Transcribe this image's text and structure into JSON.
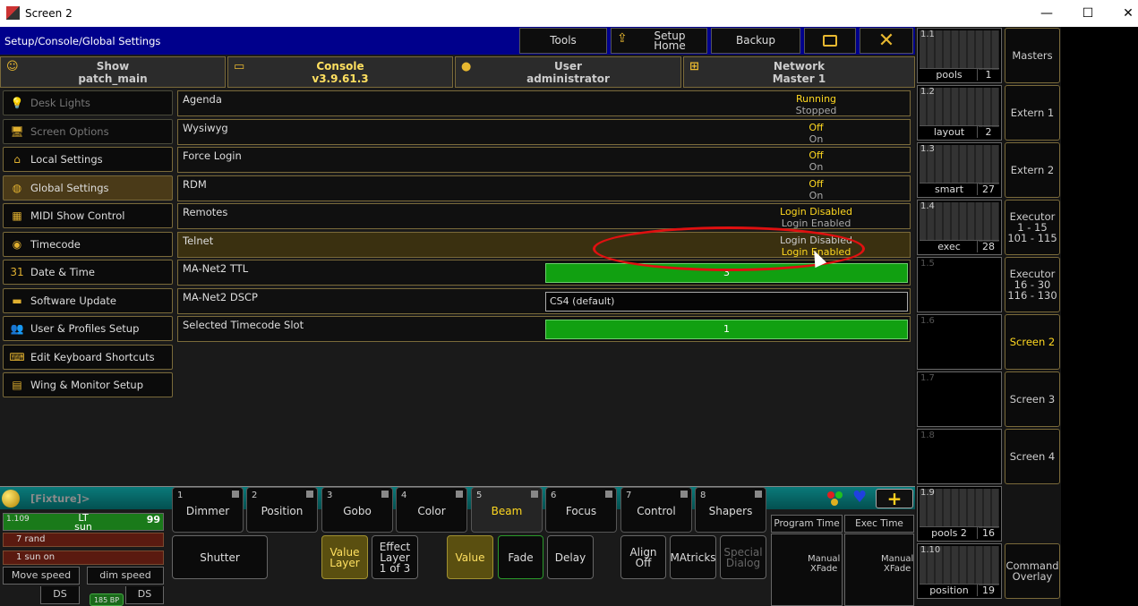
{
  "window": {
    "title": "Screen 2",
    "minimize": "—",
    "maximize": "☐",
    "close": "✕"
  },
  "pathbar": {
    "path": "Setup/Console/Global Settings",
    "tools": "Tools",
    "setup_home_1": "Setup",
    "setup_home_2": "Home",
    "backup": "Backup"
  },
  "tabs": [
    {
      "title": "Show",
      "sub": "patch_main"
    },
    {
      "title": "Console",
      "sub": "v3.9.61.3"
    },
    {
      "title": "User",
      "sub": "administrator"
    },
    {
      "title": "Network",
      "sub": "Master 1"
    }
  ],
  "sidebar": [
    {
      "label": "Desk Lights",
      "icon": "💡"
    },
    {
      "label": "Screen Options",
      "icon": "🖥"
    },
    {
      "label": "Local Settings",
      "icon": "⌂"
    },
    {
      "label": "Global Settings",
      "icon": "◍"
    },
    {
      "label": "MIDI Show Control",
      "icon": "▦"
    },
    {
      "label": "Timecode",
      "icon": "◉"
    },
    {
      "label": "Date & Time",
      "icon": "31"
    },
    {
      "label": "Software Update",
      "icon": "▬"
    },
    {
      "label": "User & Profiles Setup",
      "icon": "👥"
    },
    {
      "label": "Edit Keyboard Shortcuts",
      "icon": "⌨"
    },
    {
      "label": "Wing & Monitor Setup",
      "icon": "▤"
    }
  ],
  "settings": [
    {
      "label": "Agenda",
      "v1": "Running",
      "v2": "Stopped"
    },
    {
      "label": "Wysiwyg",
      "v1": "Off",
      "v2": "On"
    },
    {
      "label": "Force Login",
      "v1": "Off",
      "v2": "On"
    },
    {
      "label": "RDM",
      "v1": "Off",
      "v2": "On"
    },
    {
      "label": "Remotes",
      "v1": "Login Disabled",
      "v2": "Login Enabled"
    },
    {
      "label": "Telnet",
      "v1": "Login Disabled",
      "v2": "Login Enabled"
    },
    {
      "label": "MA-Net2 TTL",
      "value": "3"
    },
    {
      "label": "MA-Net2 DSCP",
      "value": "CS4 (default)"
    },
    {
      "label": "Selected Timecode Slot",
      "value": "1"
    }
  ],
  "fixture_bar": {
    "text": "[Fixture]>"
  },
  "presets": [
    {
      "num": "1",
      "label": "Dimmer"
    },
    {
      "num": "2",
      "label": "Position"
    },
    {
      "num": "3",
      "label": "Gobo"
    },
    {
      "num": "4",
      "label": "Color"
    },
    {
      "num": "5",
      "label": "Beam"
    },
    {
      "num": "6",
      "label": "Focus"
    },
    {
      "num": "7",
      "label": "Control"
    },
    {
      "num": "8",
      "label": "Shapers"
    }
  ],
  "lower_buttons": {
    "shutter": "Shutter",
    "value_layer_1": "Value",
    "value_layer_2": "Layer",
    "effect_layer_1": "Effect",
    "effect_layer_2": "Layer",
    "effect_layer_3": "1 of 3",
    "value": "Value",
    "fade": "Fade",
    "delay": "Delay",
    "align_1": "Align",
    "align_2": "Off",
    "matricks": "MAtricks",
    "special_1": "Special",
    "special_2": "Dialog"
  },
  "executor": {
    "num": "1.109",
    "name_1": "LT",
    "name_2": "sun",
    "value": "99",
    "row1": "7 rand",
    "row2": "1 sun on"
  },
  "speed": {
    "move": "Move speed",
    "dim": "dim speed",
    "ds1": "DS",
    "ds2": "DS",
    "bpm": "185 BP"
  },
  "times": {
    "program": "Program Time",
    "exec": "Exec Time",
    "manual_1": "Manual",
    "manual_2": "XFade"
  },
  "views": [
    {
      "num": "1.1",
      "name": "pools",
      "id": "1"
    },
    {
      "num": "1.2",
      "name": "layout",
      "id": "2"
    },
    {
      "num": "1.3",
      "name": "smart",
      "id": "27"
    },
    {
      "num": "1.4",
      "name": "exec",
      "id": "28"
    },
    {
      "num": "1.5"
    },
    {
      "num": "1.6"
    },
    {
      "num": "1.7"
    },
    {
      "num": "1.8"
    },
    {
      "num": "1.9",
      "name": "pools 2",
      "id": "16"
    },
    {
      "num": "1.10",
      "name": "position",
      "id": "19"
    }
  ],
  "screen_buttons": [
    {
      "l1": "Masters"
    },
    {
      "l1": "Extern 1"
    },
    {
      "l1": "Extern 2"
    },
    {
      "l1": "Executor",
      "l2": "1 - 15",
      "l3": "101 - 115"
    },
    {
      "l1": "Executor",
      "l2": "16 - 30",
      "l3": "116 - 130"
    },
    {
      "l1": "Screen 2"
    },
    {
      "l1": "Screen 3"
    },
    {
      "l1": "Screen 4"
    },
    {
      "l1": "Command",
      "l2": "Overlay"
    }
  ]
}
